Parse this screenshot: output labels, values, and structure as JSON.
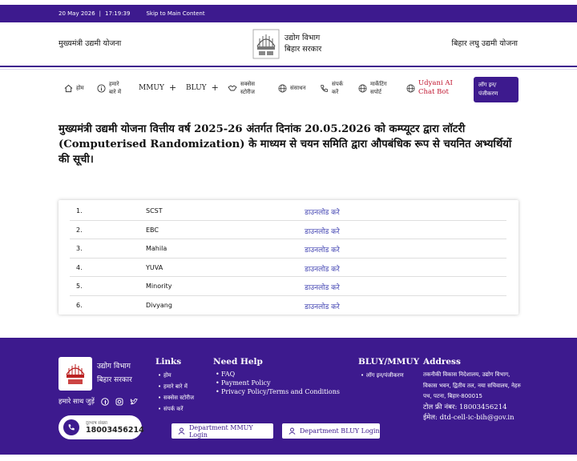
{
  "topbar": {
    "date": "20 May 2026",
    "time": "17:19:39",
    "skip": "Skip to Main Content"
  },
  "header": {
    "left_title": "मुख्यमंत्री उद्यमी योजना",
    "logo_line1": "उद्योग विभाग",
    "logo_line2": "बिहार सरकार",
    "right_title": "बिहार लघु उद्यमी योजना"
  },
  "nav": {
    "home": "होम",
    "about_1": "हमारे",
    "about_2": "बारे में",
    "mmuy": "MMUY",
    "bluy": "BLUY",
    "success_1": "सक्सेस",
    "success_2": "स्टोरीज",
    "resources": "संसाधन",
    "contact_1": "संपर्क",
    "contact_2": "करें",
    "marketing_1": "मार्केटिंग",
    "marketing_2": "सपोर्ट",
    "ai_1": "Udyani AI",
    "ai_2": "Chat Bot",
    "login_1": "लॉग इन/",
    "login_2": "पंजीकरण",
    "plus": "+"
  },
  "main": {
    "heading": "मुख्यमंत्री उद्यमी योजना वित्तीय वर्ष 2025-26 अंतर्गत दिनांक 20.05.2026 को कम्प्यूटर द्वारा लॉटरी (Computerised Randomization) के माध्यम से चयन समिति द्वारा औपबंधिक रूप से चयनित अभ्यर्थियों की सूची।",
    "rows": [
      {
        "num": "1.",
        "category": "SCST",
        "link": "डाउनलोड करे"
      },
      {
        "num": "2.",
        "category": "EBC",
        "link": "डाउनलोड करे"
      },
      {
        "num": "3.",
        "category": "Mahila",
        "link": "डाउनलोड करे"
      },
      {
        "num": "4.",
        "category": "YUVA",
        "link": "डाउनलोड करे"
      },
      {
        "num": "5.",
        "category": "Minority",
        "link": "डाउनलोड करे"
      },
      {
        "num": "6.",
        "category": "Divyang",
        "link": "डाउनलोड करे"
      }
    ]
  },
  "footer": {
    "logo_line1": "उद्योग विभाग",
    "logo_line2": "बिहार सरकार",
    "social_label": "हमारे साथ जुड़ें",
    "phone_label": "दूरभाष संख्या",
    "phone": "18003456214",
    "links_title": "Links",
    "links": [
      "होम",
      "हमारे बारे में",
      "सक्सेस स्टोरीज",
      "संपर्क करें"
    ],
    "help_title": "Need Help",
    "help": [
      "FAQ",
      "Payment Policy",
      "Privacy Policy/Terms and Conditions"
    ],
    "bluy_title": "BLUY/MMUY",
    "bluy": [
      "लॉग इन/पंजीकरण"
    ],
    "address_title": "Address",
    "address": "तकनीकी विकास निदेशालय, उद्योग विभाग, विकास भवन, द्वितीय तल, नया सचिवालय, नेहरु पथ, पटना, बिहार-800015",
    "tollfree": "टोल फ्री नंबर: 18003456214",
    "email": "ईमेल: dtd-cell-ic-bih@gov.in",
    "btn_mmuy": "Department MMUY Login",
    "btn_bluy": "Department BLUY Login"
  },
  "colors": {
    "brand": "#3d1a8e",
    "link": "#3d3fb0",
    "ai": "#c0152f"
  }
}
